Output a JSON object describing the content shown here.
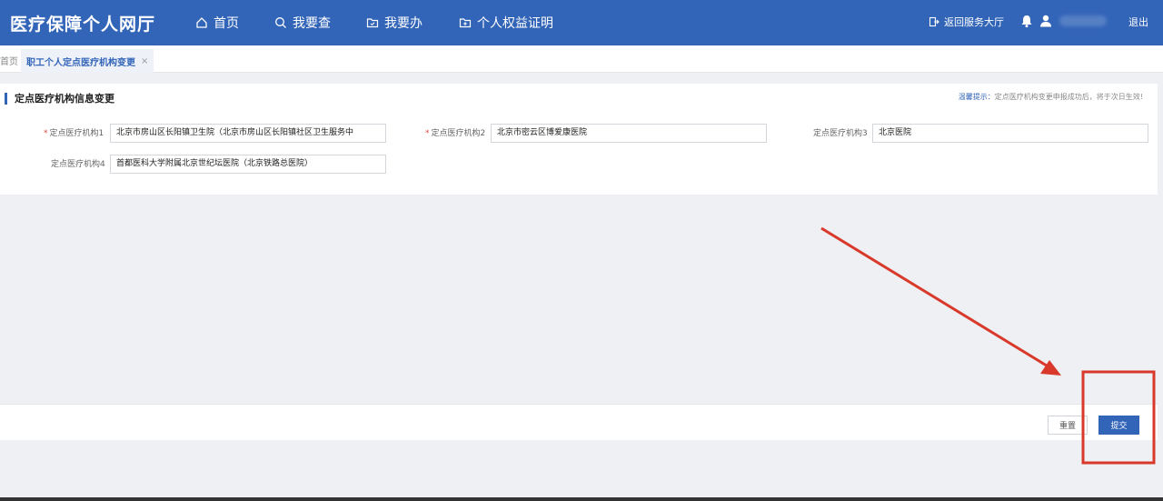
{
  "header": {
    "brand": "医疗保障个人网厅",
    "nav": [
      {
        "label": "首页",
        "icon": "home-icon"
      },
      {
        "label": "我要查",
        "icon": "search-icon"
      },
      {
        "label": "我要办",
        "icon": "folder-icon"
      },
      {
        "label": "个人权益证明",
        "icon": "folder-plus-icon"
      }
    ],
    "back_label": "返回服务大厅",
    "logout_label": "退出"
  },
  "tabs": {
    "home": "首页",
    "active": "职工个人定点医疗机构变更",
    "close": "×"
  },
  "form": {
    "title": "定点医疗机构信息变更",
    "tip_label": "温馨提示：",
    "tip_text": "定点医疗机构变更申报成功后，将于次日生效!",
    "required_mark": "*",
    "fields": [
      {
        "label": "定点医疗机构1",
        "value": "北京市房山区长阳镇卫生院（北京市房山区长阳镇社区卫生服务中"
      },
      {
        "label": "定点医疗机构2",
        "value": "北京市密云区博爱康医院"
      },
      {
        "label": "定点医疗机构3",
        "value": "北京医院"
      },
      {
        "label": "定点医疗机构4",
        "value": "首都医科大学附属北京世纪坛医院（北京铁路总医院）"
      }
    ]
  },
  "actions": {
    "reset": "重置",
    "submit": "提交"
  },
  "colors": {
    "brand_blue": "#3264b8",
    "annotation_red": "#d9392b"
  }
}
